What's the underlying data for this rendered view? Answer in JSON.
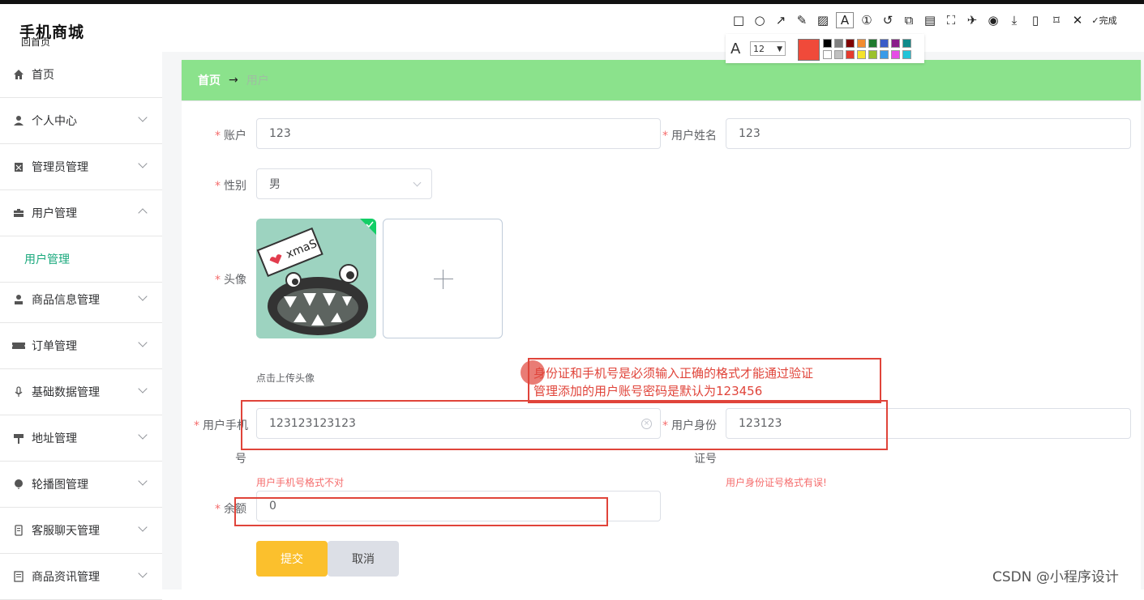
{
  "app": {
    "title": "手机商城",
    "subtitle": "回首页"
  },
  "sidebar": {
    "items": [
      {
        "label": "首页",
        "icon": "home-icon"
      },
      {
        "label": "个人中心",
        "icon": "user-icon"
      },
      {
        "label": "管理员管理",
        "icon": "clipboard-icon"
      },
      {
        "label": "用户管理",
        "icon": "briefcase-icon"
      },
      {
        "label": "商品信息管理",
        "icon": "person-stand-icon"
      },
      {
        "label": "订单管理",
        "icon": "ticket-icon"
      },
      {
        "label": "基础数据管理",
        "icon": "microphone-icon"
      },
      {
        "label": "地址管理",
        "icon": "signpost-icon"
      },
      {
        "label": "轮播图管理",
        "icon": "balloon-icon"
      },
      {
        "label": "客服聊天管理",
        "icon": "mobile-icon"
      },
      {
        "label": "商品资讯管理",
        "icon": "document-icon"
      }
    ],
    "sub_item": "用户管理"
  },
  "breadcrumb": {
    "home": "首页",
    "arrow": "→",
    "current": "用户"
  },
  "form": {
    "account_label": "账户",
    "account_value": "123",
    "name_label": "用户姓名",
    "name_value": "123",
    "gender_label": "性别",
    "gender_value": "男",
    "avatar_label": "头像",
    "avatar_hint": "点击上传头像",
    "phone_label_1": "用户手机",
    "phone_label_2": "号",
    "phone_value": "123123123123",
    "phone_error": "用户手机号格式不对",
    "idcard_label_1": "用户身份",
    "idcard_label_2": "证号",
    "idcard_value": "123123",
    "idcard_error": "用户身份证号格式有误!",
    "balance_label": "余额",
    "balance_value": "0",
    "submit": "提交",
    "cancel": "取消",
    "required_mark": "*"
  },
  "annotation": {
    "line1": "身份证和手机号是必须输入正确的格式才能通过验证",
    "line2": "管理添加的用户账号密码是默认为123456"
  },
  "toolbar": {
    "font_size": "12",
    "finish": "完成"
  },
  "watermark": "CSDN @小程序设计",
  "colors": {
    "accent": "#1aa97d",
    "breadcrumb_bg": "#8be28c",
    "submit_bg": "#fbc02d",
    "error": "#f56c6c",
    "annotation": "#e0443a"
  }
}
